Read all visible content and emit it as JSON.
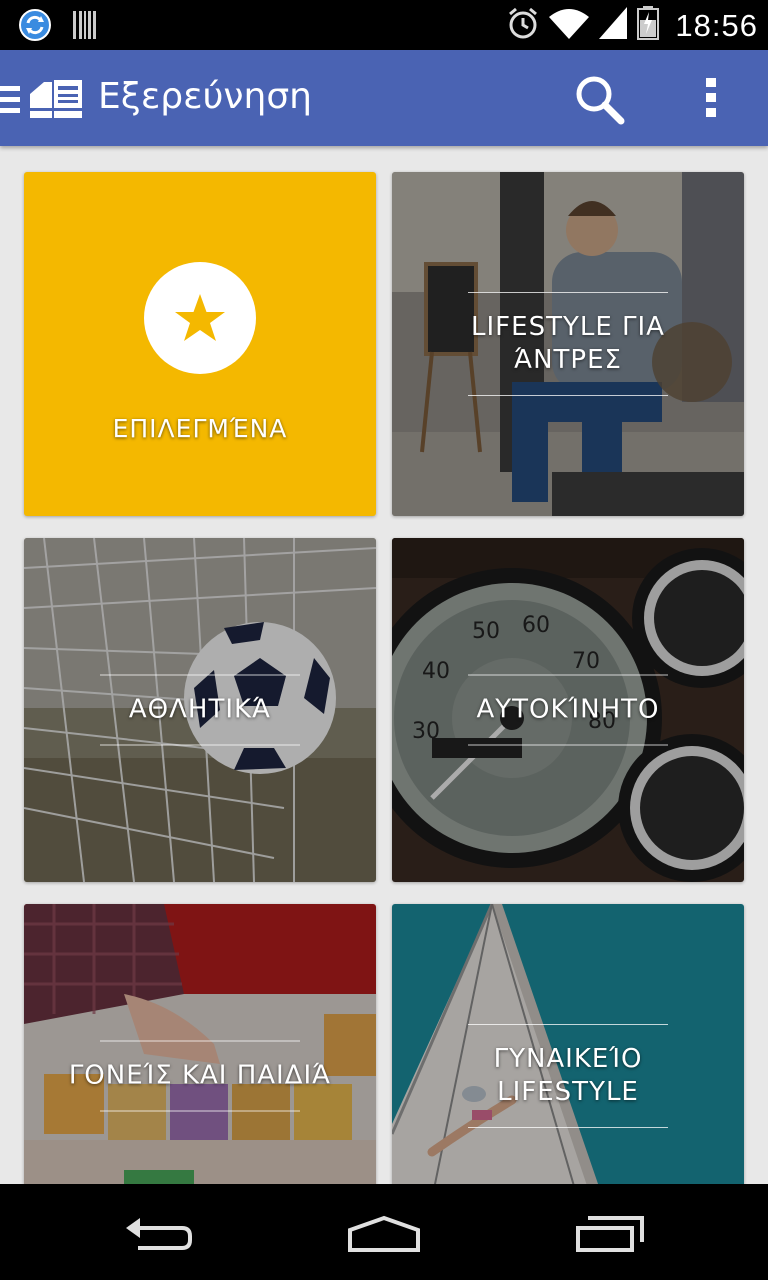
{
  "status_bar": {
    "time": "18:56",
    "left_icons": [
      "sync-icon",
      "barcode-icon"
    ],
    "right_icons": [
      "alarm-icon",
      "wifi-icon",
      "signal-icon",
      "battery-icon"
    ]
  },
  "app_bar": {
    "title": "Εξερεύνηση",
    "menu_icon": "menu-icon",
    "app_icon": "newsstand-icon",
    "search_icon": "search-icon",
    "overflow_icon": "overflow-menu-icon"
  },
  "tiles": [
    {
      "label": "ΕΠΙΛΕΓΜΈΝΑ",
      "icon": "star-icon",
      "color": "#f4b800"
    },
    {
      "label": "LIFESTYLE ΓΙΑ ΆΝΤΡΕΣ"
    },
    {
      "label": "ΑΘΛΗΤΙΚΆ"
    },
    {
      "label": "ΑΥΤΟΚΊΝΗΤΟ"
    },
    {
      "label": "ΓΟΝΕΊΣ ΚΑΙ ΠΑΙΔΙΆ"
    },
    {
      "label": "ΓΥΝΑΙΚΕΊΟ LIFESTYLE"
    }
  ],
  "nav_bar": {
    "buttons": [
      "back-icon",
      "home-icon",
      "recents-icon"
    ]
  },
  "colors": {
    "app_bar": "#4a63b3",
    "featured": "#f4b800",
    "background": "#e8e8e8"
  }
}
